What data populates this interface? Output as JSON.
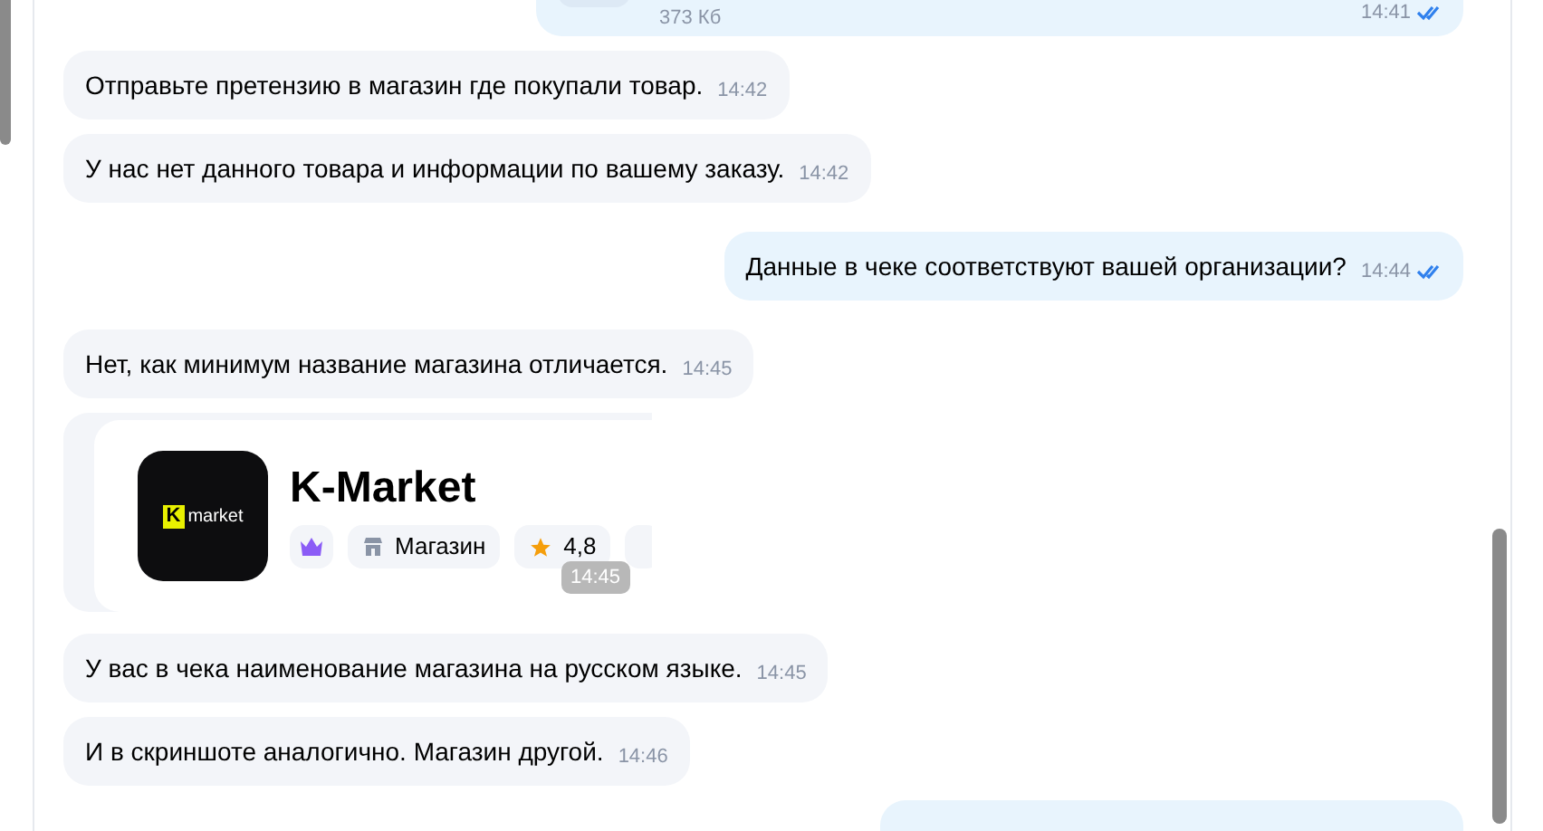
{
  "messages": [
    {
      "kind": "file",
      "outgoing": true,
      "size": "373 Кб",
      "time": "14:41",
      "read": true
    },
    {
      "kind": "text",
      "outgoing": false,
      "text": "Отправьте претензию в магазин где покупали товар.",
      "time": "14:42"
    },
    {
      "kind": "text",
      "outgoing": false,
      "text": "У нас нет данного товара и информации по вашему заказу.",
      "time": "14:42"
    },
    {
      "kind": "text",
      "outgoing": true,
      "text": "Данные в чеке соответствуют вашей организации?",
      "time": "14:44",
      "read": true
    },
    {
      "kind": "text",
      "outgoing": false,
      "text": "Нет, как минимум название магазина отличается.",
      "time": "14:45"
    },
    {
      "kind": "card",
      "outgoing": false,
      "logo_mark": "K",
      "logo_word": "market",
      "title": "K-Market",
      "chips": [
        {
          "kind": "badge"
        },
        {
          "kind": "category",
          "label": "Магазин"
        },
        {
          "kind": "rating",
          "label": "4,8"
        },
        {
          "kind": "more"
        }
      ],
      "time": "14:45"
    },
    {
      "kind": "text",
      "outgoing": false,
      "text": "У вас в чека наименование магазина на русском языке.",
      "time": "14:45"
    },
    {
      "kind": "text",
      "outgoing": false,
      "text": "И в скриншоте аналогично. Магазин другой.",
      "time": "14:46"
    },
    {
      "kind": "empty",
      "outgoing": true
    }
  ]
}
